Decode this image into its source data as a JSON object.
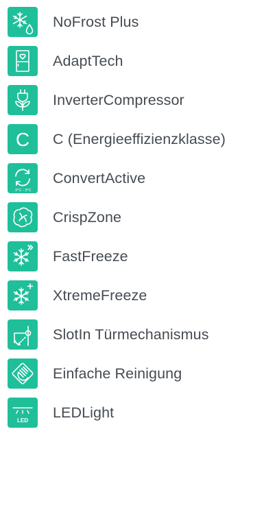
{
  "accent_color": "#1fbf9a",
  "text_color": "#454b52",
  "features": [
    {
      "label": "NoFrost Plus",
      "icon": "snowflake-drop-icon"
    },
    {
      "label": "AdaptTech",
      "icon": "fridge-heart-icon"
    },
    {
      "label": "InverterCompressor",
      "icon": "plug-leaf-icon"
    },
    {
      "label": "C (Energieeffizienzklasse)",
      "icon": "energy-class-c-icon",
      "icon_text": "C"
    },
    {
      "label": "ConvertActive",
      "icon": "convert-arrows-icon",
      "icon_text": "-2°C - 3°C"
    },
    {
      "label": "CrispZone",
      "icon": "lettuce-icon"
    },
    {
      "label": "FastFreeze",
      "icon": "snowflake-fast-icon"
    },
    {
      "label": "XtremeFreeze",
      "icon": "snowflake-plus-icon"
    },
    {
      "label": "SlotIn Türmechanismus",
      "icon": "door-hinge-icon"
    },
    {
      "label": "Einfache Reinigung",
      "icon": "hand-wipe-icon"
    },
    {
      "label": "LEDLight",
      "icon": "led-light-icon",
      "icon_text": "LED"
    }
  ]
}
